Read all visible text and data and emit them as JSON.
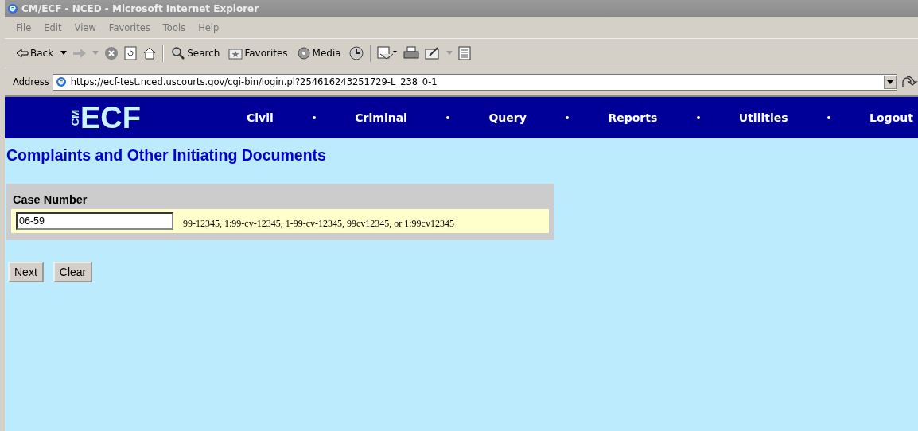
{
  "window": {
    "title": "CM/ECF - NCED - Microsoft Internet Explorer"
  },
  "menu": [
    "File",
    "Edit",
    "View",
    "Favorites",
    "Tools",
    "Help"
  ],
  "toolbar": {
    "back": "Back",
    "search": "Search",
    "favorites": "Favorites",
    "media": "Media"
  },
  "address": {
    "label": "Address",
    "url": "https://ecf-test.nced.uscourts.gov/cgi-bin/login.pl?254616243251729-L_238_0-1"
  },
  "logo": {
    "small": "CM",
    "big": "ECF"
  },
  "nav": [
    "Civil",
    "Criminal",
    "Query",
    "Reports",
    "Utilities",
    "Logout"
  ],
  "heading": "Complaints and Other Initiating Documents",
  "form": {
    "label": "Case Number",
    "value": "06-59",
    "hint": "99-12345, 1:99-cv-12345, 1-99-cv-12345, 99cv12345, or 1:99cv12345"
  },
  "buttons": [
    "Next",
    "Clear"
  ]
}
